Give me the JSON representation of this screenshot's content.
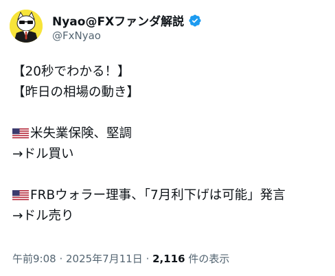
{
  "author": {
    "display_name": "Nyao@FXファンダ解説",
    "handle": "@FxNyao",
    "verified": true,
    "avatar_icon": "cat-avatar-icon",
    "verified_icon": "verified-badge-icon",
    "avatar_bg": "#f7e43a",
    "verified_color": "#1d9bf0"
  },
  "post": {
    "line1": "【20秒でわかる！】",
    "line2": "【昨日の相場の動き】",
    "item1_flag": "us-flag-icon",
    "item1_title": "米失業保険、堅調",
    "item1_result": "→ドル買い",
    "item2_flag": "us-flag-icon",
    "item2_title": "FRBウォラー理事、「7月利下げは可能」発言",
    "item2_result": "→ドル売り"
  },
  "meta": {
    "time": "午前9:08",
    "separator": " · ",
    "date": "2025年7月11日",
    "views_count": "2,116",
    "views_label": " 件の表示"
  }
}
